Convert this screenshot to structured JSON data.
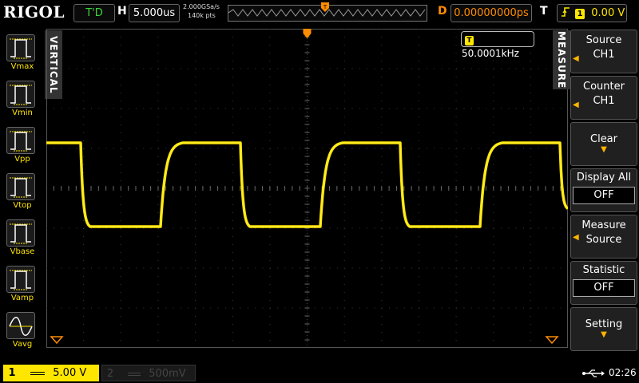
{
  "header": {
    "brand": "RIGOL",
    "run_status": "T'D",
    "timebase_label": "H",
    "timebase_value": "5.000us",
    "sample_rate": "2.000GSa/s",
    "memory_depth": "140k pts",
    "delay_label": "D",
    "delay_value": "0.00000000ps",
    "trigger_label": "T",
    "trigger_channel": "1",
    "trigger_level": "0.00 V"
  },
  "vertical_tab": "VERTICAL",
  "measure_tab": "MEASURE",
  "measurements": [
    {
      "label": "Vmax",
      "icon": "vmax-icon"
    },
    {
      "label": "Vmin",
      "icon": "vmin-icon"
    },
    {
      "label": "Vpp",
      "icon": "vpp-icon"
    },
    {
      "label": "Vtop",
      "icon": "vtop-icon"
    },
    {
      "label": "Vbase",
      "icon": "vbase-icon"
    },
    {
      "label": "Vamp",
      "icon": "vamp-icon"
    },
    {
      "label": "Vavg",
      "icon": "vavg-icon"
    }
  ],
  "frequency_counter": {
    "channel": "T",
    "value": "50.0001kHz"
  },
  "menu": {
    "source_title": "Source",
    "source_value": "CH1",
    "counter_title": "Counter",
    "counter_value": "CH1",
    "clear_title": "Clear",
    "display_all_title": "Display All",
    "display_all_value": "OFF",
    "measure_source_line1": "Measure",
    "measure_source_line2": "Source",
    "statistic_title": "Statistic",
    "statistic_value": "OFF",
    "setting_title": "Setting"
  },
  "channels": {
    "ch1_number": "1",
    "ch1_scale": "5.00 V",
    "ch2_number": "2",
    "ch2_scale": "500mV"
  },
  "status": {
    "time": "02:26"
  },
  "colors": {
    "ch1": "#ffe600",
    "trigger": "#ff8c00",
    "grid": "#3a3a3a"
  }
}
